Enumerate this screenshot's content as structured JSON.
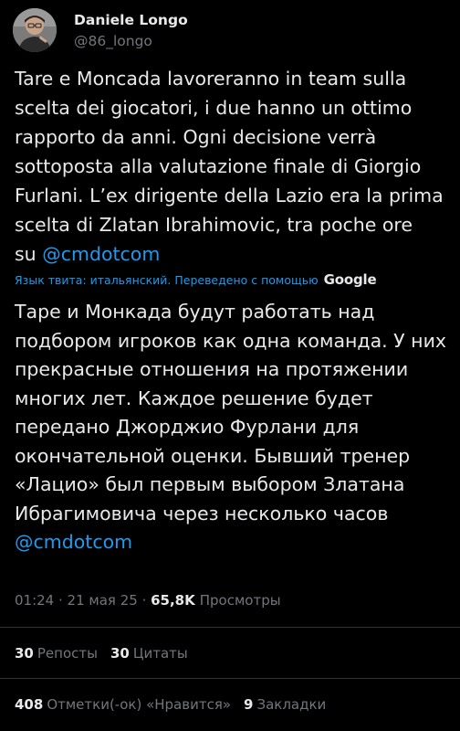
{
  "author": {
    "display_name": "Daniele Longo",
    "handle": "@86_longo"
  },
  "tweet": {
    "text_line_1": "Tare e Moncada lavoreranno in team sulla",
    "text_line_2": "scelta dei giocatori, i due hanno un ottimo",
    "text_line_3": "rapporto da anni. Ogni decisione verrà",
    "text_line_4": "sottoposta alla valutazione finale di Giorgio",
    "text_line_5": "Furlani. L’ex dirigente della Lazio era la prima",
    "text_line_6": "scelta di Zlatan Ibrahimovic, tra poche ore",
    "text_line_7_prefix": "su ",
    "mention": "@cmdotcom"
  },
  "translation": {
    "notice": "Язык твита: итальянский. Переведено с помощью",
    "provider": "Google",
    "line_1": "Таре и Монкада будут работать над",
    "line_2": "подбором игроков как одна команда. У них",
    "line_3": "прекрасные отношения на протяжении",
    "line_4": "многих лет. Каждое решение будет",
    "line_5": "передано Джорджио Фурлани для",
    "line_6": "окончательной оценки. Бывший тренер",
    "line_7": "«Лацио» был первым выбором Златана",
    "line_8": "Ибрагимовича через несколько часов",
    "mention": "@cmdotcom"
  },
  "meta": {
    "time": "01:24",
    "separator_1": " · ",
    "date": "21 мая 25",
    "separator_2": " · ",
    "views_count": "65,8K",
    "views_label": "Просмотры"
  },
  "stats_1": {
    "reposts_count": "30",
    "reposts_label": "Репосты",
    "quotes_count": "30",
    "quotes_label": "Цитаты"
  },
  "stats_2": {
    "likes_count": "408",
    "likes_label": "Отметки(-ок) «Нравится»",
    "bookmarks_count": "9",
    "bookmarks_label": "Закладки"
  },
  "colors": {
    "background": "#000000",
    "text": "#e7e9ea",
    "secondary": "#71767b",
    "link": "#1d9bf0",
    "divider": "#2f3336"
  }
}
